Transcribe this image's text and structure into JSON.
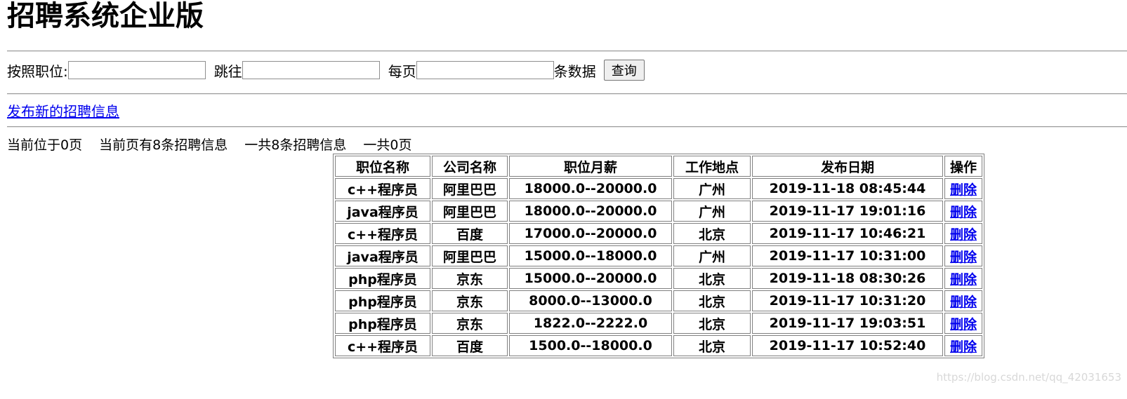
{
  "title": "招聘系统企业版",
  "search": {
    "position_label": "按照职位:",
    "position_value": "",
    "goto_label": "跳往",
    "goto_value": "",
    "per_page_label": "每页",
    "per_page_value": "",
    "per_page_suffix": "条数据",
    "query_label": "查询"
  },
  "publish_link": "发布新的招聘信息",
  "page_info": {
    "current_page": "当前位于0页",
    "current_count": "当前页有8条招聘信息",
    "total_count": "一共8条招聘信息",
    "total_pages": "一共0页"
  },
  "table": {
    "headers": [
      "职位名称",
      "公司名称",
      "职位月薪",
      "工作地点",
      "发布日期",
      "操作"
    ],
    "rows": [
      {
        "position": "c++程序员",
        "company": "阿里巴巴",
        "salary": "18000.0--20000.0",
        "location": "广州",
        "date": "2019-11-18 08:45:44",
        "action": "删除"
      },
      {
        "position": "java程序员",
        "company": "阿里巴巴",
        "salary": "18000.0--20000.0",
        "location": "广州",
        "date": "2019-11-17 19:01:16",
        "action": "删除"
      },
      {
        "position": "c++程序员",
        "company": "百度",
        "salary": "17000.0--20000.0",
        "location": "北京",
        "date": "2019-11-17 10:46:21",
        "action": "删除"
      },
      {
        "position": "java程序员",
        "company": "阿里巴巴",
        "salary": "15000.0--18000.0",
        "location": "广州",
        "date": "2019-11-17 10:31:00",
        "action": "删除"
      },
      {
        "position": "php程序员",
        "company": "京东",
        "salary": "15000.0--20000.0",
        "location": "北京",
        "date": "2019-11-18 08:30:26",
        "action": "删除"
      },
      {
        "position": "php程序员",
        "company": "京东",
        "salary": "8000.0--13000.0",
        "location": "北京",
        "date": "2019-11-17 10:31:20",
        "action": "删除"
      },
      {
        "position": "php程序员",
        "company": "京东",
        "salary": "1822.0--2222.0",
        "location": "北京",
        "date": "2019-11-17 19:03:51",
        "action": "删除"
      },
      {
        "position": "c++程序员",
        "company": "百度",
        "salary": "1500.0--18000.0",
        "location": "北京",
        "date": "2019-11-17 10:52:40",
        "action": "删除"
      }
    ]
  },
  "watermark": "https://blog.csdn.net/qq_42031653"
}
